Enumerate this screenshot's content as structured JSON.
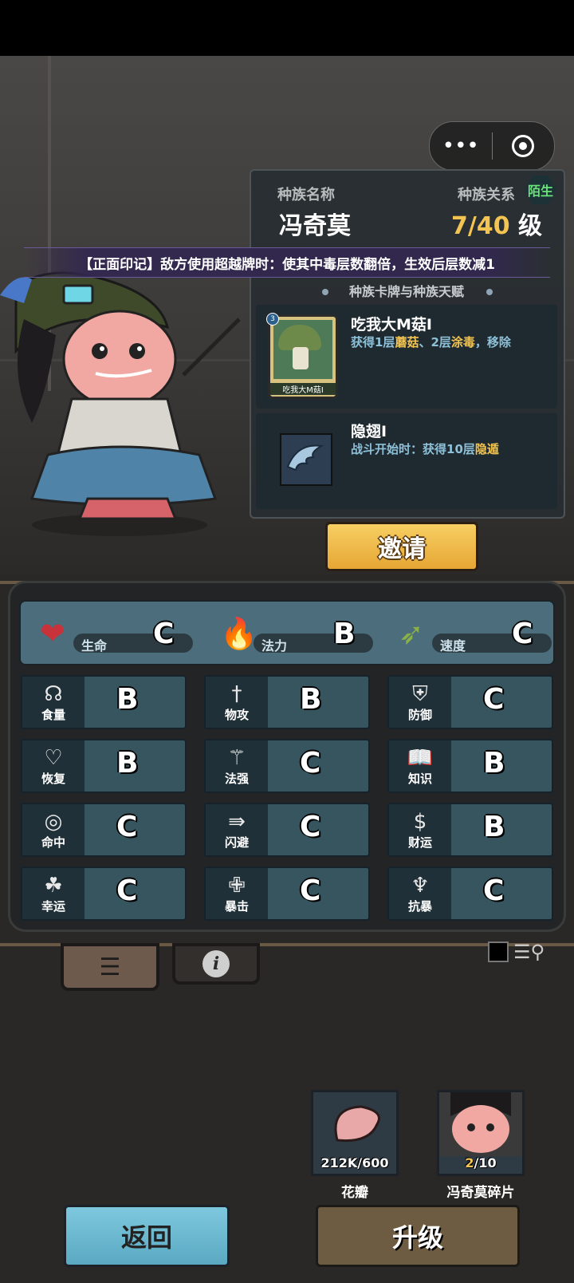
{
  "capsule": {
    "more_icon": "more-dots-icon",
    "close_icon": "target-circle-icon"
  },
  "race_panel": {
    "name_label": "种族名称",
    "name": "冯奇莫",
    "relation_label": "种族关系",
    "relation_badge": "陌生",
    "level_value": "7/40",
    "level_unit": "级"
  },
  "mark_text": "【正面印记】敌方使用超越牌时：使其中毒层数翻倍，生效后层数减1",
  "section_title": "种族卡牌与种族天赋",
  "cards": [
    {
      "title": "吃我大M菇Ⅰ",
      "desc_parts": [
        "获得1层",
        "蘑菇",
        "、2层",
        "涂毒",
        "，移除"
      ],
      "card_label": "吃我大M菇Ⅰ",
      "badge": "3",
      "icon": "mushroom-card-icon"
    },
    {
      "title": "隐翅Ⅰ",
      "desc_parts": [
        "战斗开始时：获得10层",
        "隐遁"
      ],
      "icon": "wing-icon"
    }
  ],
  "invite_label": "邀请",
  "top_stats": [
    {
      "name": "生命",
      "grade": "C",
      "icon": "heart-icon"
    },
    {
      "name": "法力",
      "grade": "B",
      "icon": "flame-icon"
    },
    {
      "name": "速度",
      "grade": "C",
      "icon": "wing-boot-icon"
    }
  ],
  "stats": [
    {
      "name": "食量",
      "grade": "B",
      "icon": "stomach-icon"
    },
    {
      "name": "物攻",
      "grade": "B",
      "icon": "sword-icon"
    },
    {
      "name": "防御",
      "grade": "C",
      "icon": "armor-icon"
    },
    {
      "name": "恢复",
      "grade": "B",
      "icon": "heart-plus-icon"
    },
    {
      "name": "法强",
      "grade": "C",
      "icon": "staff-icon"
    },
    {
      "name": "知识",
      "grade": "B",
      "icon": "book-icon"
    },
    {
      "name": "命中",
      "grade": "C",
      "icon": "target-icon"
    },
    {
      "name": "闪避",
      "grade": "C",
      "icon": "dodge-arrows-icon"
    },
    {
      "name": "财运",
      "grade": "B",
      "icon": "coin-icon"
    },
    {
      "name": "幸运",
      "grade": "C",
      "icon": "clover-icon"
    },
    {
      "name": "暴击",
      "grade": "C",
      "icon": "crit-icon"
    },
    {
      "name": "抗暴",
      "grade": "C",
      "icon": "shell-icon"
    }
  ],
  "tabs": {
    "list_icon": "list-icon",
    "info_icon": "info-icon",
    "info_glyph": "i"
  },
  "resources": [
    {
      "name": "花瓣",
      "count": "212K/600",
      "icon": "petal-icon"
    },
    {
      "name": "冯奇莫碎片",
      "count_have": "2",
      "count_need": "/10",
      "icon": "fragment-portrait-icon"
    }
  ],
  "buttons": {
    "back": "返回",
    "upgrade": "升级"
  },
  "colors": {
    "accent_gold": "#f3c451",
    "relation_green": "#69e27a",
    "desc_blue": "#8ec0d8"
  }
}
